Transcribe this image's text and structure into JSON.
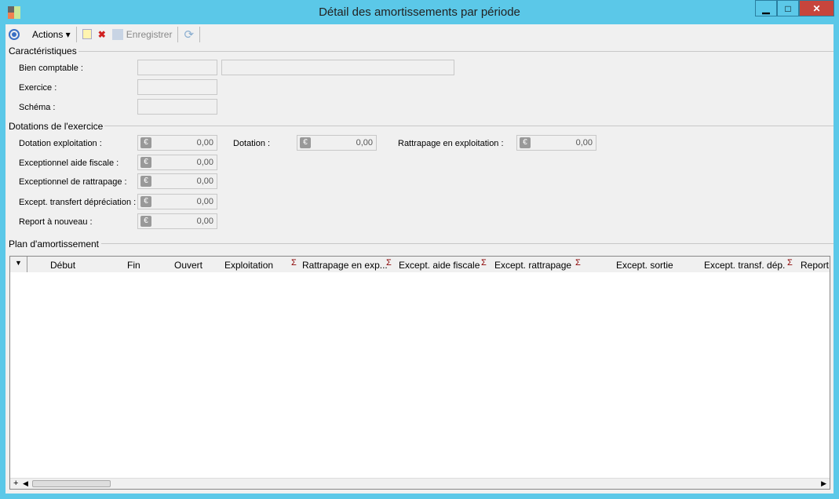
{
  "window": {
    "title": "Détail des amortissements par période",
    "minimize": "▁",
    "maximize": "□",
    "close": "✕"
  },
  "toolbar": {
    "actions": "Actions ▾",
    "save": "Enregistrer"
  },
  "caracteristiques": {
    "title": "Caractéristiques",
    "bien": "Bien comptable :",
    "exercice": "Exercice :",
    "schema": "Schéma :"
  },
  "dotations": {
    "title": "Dotations de l'exercice",
    "dotation_exploitation": {
      "label": "Dotation exploitation :",
      "value": "0,00"
    },
    "dotation": {
      "label": "Dotation :",
      "value": "0,00"
    },
    "rattrapage_exploitation": {
      "label": "Rattrapage en exploitation :",
      "value": "0,00"
    },
    "exceptionnel_aide": {
      "label": "Exceptionnel aide fiscale :",
      "value": "0,00"
    },
    "exceptionnel_rattrapage": {
      "label": "Exceptionnel de rattrapage :",
      "value": "0,00"
    },
    "except_transfert": {
      "label": "Except. transfert dépréciation :",
      "value": "0,00"
    },
    "report": {
      "label": "Report à nouveau :",
      "value": "0,00"
    },
    "currency": "€"
  },
  "plan": {
    "title": "Plan d'amortissement",
    "columns": [
      "Début",
      "Fin",
      "Ouvert",
      "Exploitation",
      "Rattrapage en exp...",
      "Except. aide fiscale",
      "Except. rattrapage",
      "Except. sortie",
      "Except. transf. dép.",
      "Report"
    ],
    "sigma": "Σ",
    "add": "+"
  }
}
